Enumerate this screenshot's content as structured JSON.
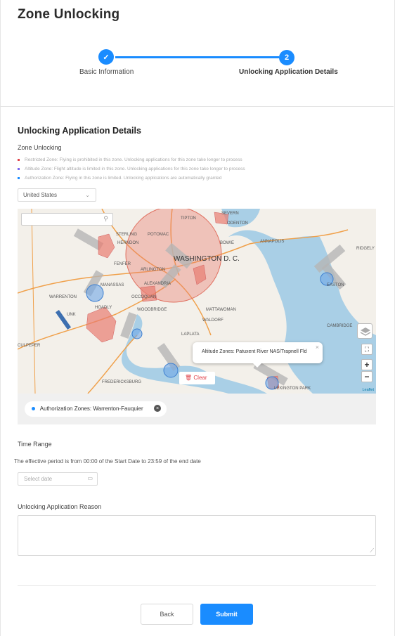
{
  "page": {
    "title": "Zone Unlocking"
  },
  "steps": [
    {
      "number": "✓",
      "label": "Basic Information"
    },
    {
      "number": "2",
      "label": "Unlocking Application Details"
    }
  ],
  "details": {
    "section_title": "Unlocking Application Details",
    "zone_label": "Zone Unlocking",
    "legend": [
      {
        "text": "Restricted Zone: Flying is prohibited in this zone. Unlocking applications for this zone take longer to process",
        "color": "#e0424a"
      },
      {
        "text": "Altitude Zone: Flight altitude is limited in this zone. Unlocking applications for this zone take longer to process",
        "color": "#7b68ee"
      },
      {
        "text": "Authorization Zone: Flying in this zone is limited. Unlocking applications are automatically granted",
        "color": "#1a8cff"
      }
    ],
    "country_select": "United States"
  },
  "map": {
    "labels": [
      {
        "text": "TIPTON"
      },
      {
        "text": "SEVERN"
      },
      {
        "text": "ODENTON"
      },
      {
        "text": "POTOMAC"
      },
      {
        "text": "STERLING"
      },
      {
        "text": "HERNDON"
      },
      {
        "text": "BOWIE"
      },
      {
        "text": "ANNAPOLIS"
      },
      {
        "text": "WASHINGTON D. C."
      },
      {
        "text": "FENFER"
      },
      {
        "text": "ARLINGTON"
      },
      {
        "text": "ALEXANDRIA"
      },
      {
        "text": "MANASSAS"
      },
      {
        "text": "WARRENTON"
      },
      {
        "text": "OCCOQUAN"
      },
      {
        "text": "WOODBRIDGE"
      },
      {
        "text": "HOADLY"
      },
      {
        "text": "UNK"
      },
      {
        "text": "MATTAWOMAN"
      },
      {
        "text": "WALDORF"
      },
      {
        "text": "LAPLATA"
      },
      {
        "text": "EASTON"
      },
      {
        "text": "CAMBRIDGE"
      },
      {
        "text": "CULPEPER"
      },
      {
        "text": "FREDERICKSBURG"
      },
      {
        "text": "LEXINGTON PARK"
      },
      {
        "text": "RIDGELY"
      }
    ],
    "tooltip": "Altitude Zones: Patuxent River NAS/Trapnell Fld",
    "clear_label": "Clear",
    "attribution": "Leaflet",
    "zoom_in": "+",
    "zoom_out": "−",
    "selected_zone": "Authorization Zones: Warrenton-Fauquier"
  },
  "time_range": {
    "label": "Time Range",
    "note": "The effective period is from 00:00 of the Start Date to 23:59 of the end date",
    "date_placeholder": "Select date"
  },
  "reason": {
    "label": "Unlocking Application Reason"
  },
  "actions": {
    "back": "Back",
    "submit": "Submit"
  },
  "colors": {
    "accent": "#1a8cff",
    "restricted": "#e0424a",
    "water": "#a9cfe6"
  }
}
